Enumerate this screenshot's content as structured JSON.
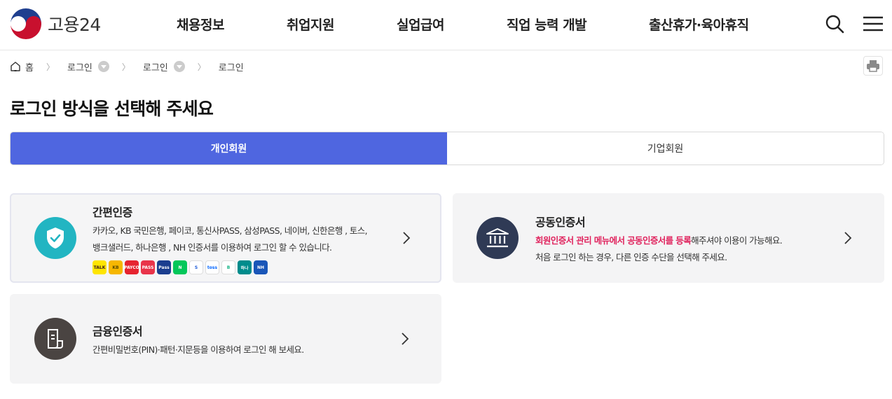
{
  "header": {
    "logo_text": "고용24",
    "nav": [
      "채용정보",
      "취업지원",
      "실업급여",
      "직업 능력 개발",
      "출산휴가·육아휴직"
    ],
    "icons": [
      "search-icon",
      "menu-icon"
    ]
  },
  "breadcrumb": {
    "home": "홈",
    "items": [
      "로그인",
      "로그인",
      "로그인"
    ]
  },
  "page_title": "로그인 방식을 선택해 주세요",
  "tabs": [
    {
      "label": "개인회원",
      "active": true
    },
    {
      "label": "기업회원",
      "active": false
    }
  ],
  "cards": {
    "simple": {
      "title": "간편인증",
      "desc1": "카카오, KB 국민은행, 페이코, 통신사PASS, 삼성PASS, 네이버, 신한은행 , 토스,",
      "desc2": "뱅크샐러드, 하나은행 , NH 인증서를 이용하여 로그인 할 수 있습니다.",
      "providers": [
        {
          "label": "TALK",
          "color": "#fee500",
          "fg": "#3a1d1d"
        },
        {
          "label": "KB",
          "color": "#f6b700",
          "fg": "#5a4a00"
        },
        {
          "label": "PAYCO",
          "color": "#e6232f",
          "fg": "#ffffff"
        },
        {
          "label": "PASS",
          "color": "#e9344a",
          "fg": "#ffffff"
        },
        {
          "label": "Pass",
          "color": "#1b3e8f",
          "fg": "#ffffff"
        },
        {
          "label": "N",
          "color": "#03c75a",
          "fg": "#ffffff"
        },
        {
          "label": "S",
          "color": "#ffffff",
          "fg": "#1d5bd8"
        },
        {
          "label": "toss",
          "color": "#ffffff",
          "fg": "#0064ff"
        },
        {
          "label": "B",
          "color": "#ffffff",
          "fg": "#17b486"
        },
        {
          "label": "하나",
          "color": "#008c8c",
          "fg": "#ffffff"
        },
        {
          "label": "NH",
          "color": "#1a56b8",
          "fg": "#ffffff"
        }
      ]
    },
    "joint": {
      "title": "공동인증서",
      "desc1_hl": "회원인증서 관리 메뉴에서 공동인증서를 등록",
      "desc1_rest": "해주셔야 이용이 가능해요.",
      "desc2": "처음 로그인 하는 경우, 다른 인증 수단을 선택해 주세요."
    },
    "financial": {
      "title": "금융인증서",
      "desc1": "간편비밀번호(PIN)·패턴·지문등을 이용하여 로그인 해 보세요."
    }
  },
  "colors": {
    "accent": "#4f66e0",
    "highlight": "#e0245e",
    "simple_icon_bg": "#22b5c2",
    "joint_icon_bg": "#2f3a55",
    "financial_icon_bg": "#4a4442"
  }
}
